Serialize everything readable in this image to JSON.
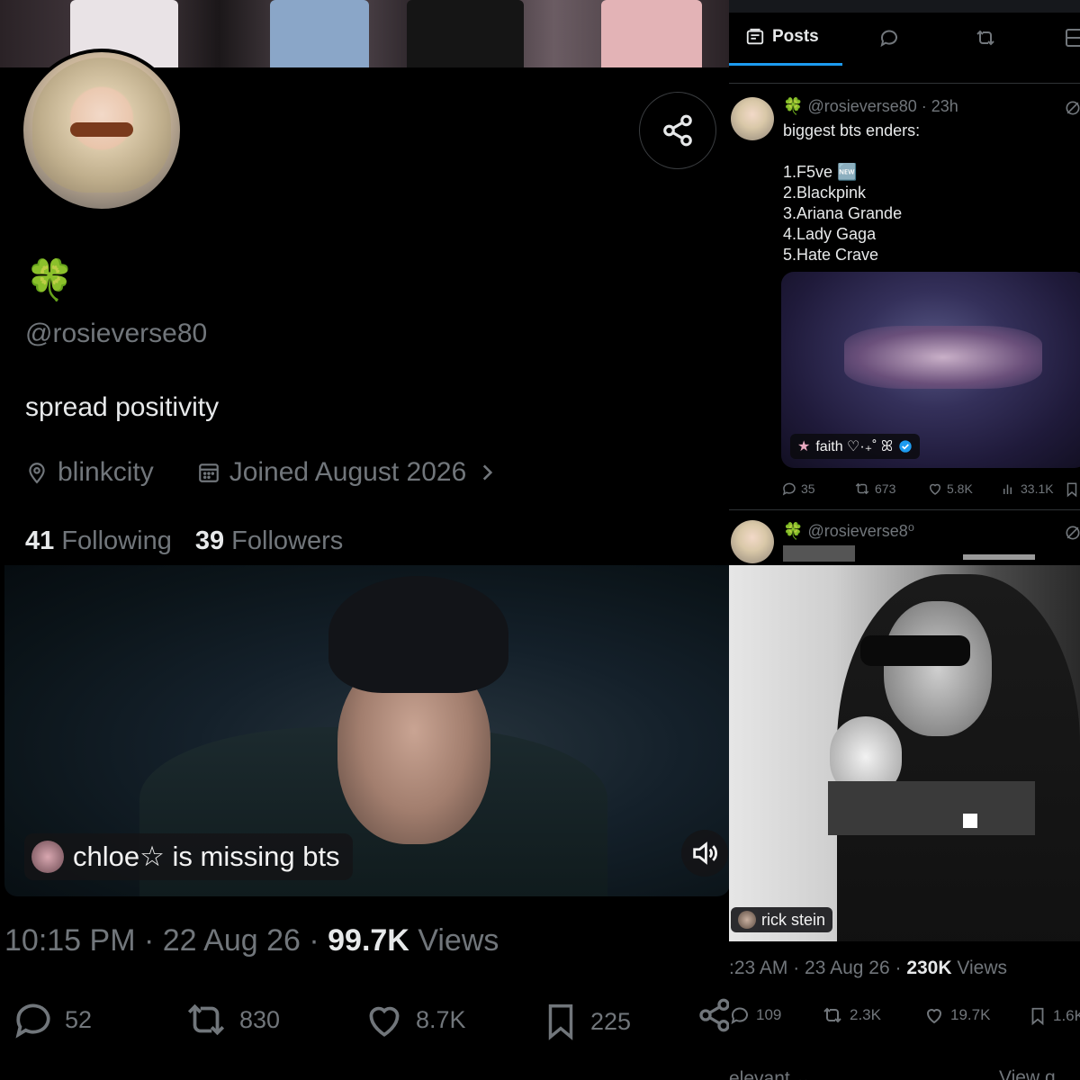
{
  "left_profile": {
    "name_emoji": "🍀",
    "handle": "@rosieverse80",
    "bio": "spread positivity",
    "location": "blinkcity",
    "joined": "Joined August 2026",
    "following_count": "41",
    "following_label": "Following",
    "followers_count": "39",
    "followers_label": "Followers"
  },
  "left_post": {
    "caption_chip": "chloe☆ is missing bts",
    "time": "10:15 PM",
    "date": "22 Aug 26",
    "views_count": "99.7K",
    "views_label": "Views",
    "replies": "52",
    "reposts": "830",
    "likes": "8.7K",
    "bookmarks": "225"
  },
  "right_tabs": {
    "posts_label": "Posts"
  },
  "right_post_1": {
    "clover": "🍀",
    "handle": "@rosieverse80",
    "time": "· 23h",
    "text": "biggest bts enders:\n\n1.F5ve 🆕\n2.Blackpink\n3.Ariana Grande\n4.Lady Gaga\n5.Hate Crave",
    "media_chip": "faith ♡·₊˚ ꕤ",
    "replies": "35",
    "reposts": "673",
    "likes": "5.8K",
    "views": "33.1K"
  },
  "right_post_2": {
    "clover": "🍀",
    "handle": "@rosieverse8⁰",
    "media_chip": "rick stein",
    "time": ":23 AM",
    "date": "23 Aug 26",
    "views_count": "230K",
    "views_label": "Views",
    "replies": "109",
    "reposts": "2.3K",
    "likes": "19.7K",
    "bookmarks": "1.6K"
  },
  "right_bottom": {
    "relevant_label": "elevant ⌄",
    "view_link": "View q"
  },
  "colors": {
    "background": "#000000",
    "text_primary": "#e7e9ea",
    "text_secondary": "#71767b",
    "accent": "#1d9bf0",
    "verified": "#1d9bf0",
    "clover": "#3aa83a"
  }
}
